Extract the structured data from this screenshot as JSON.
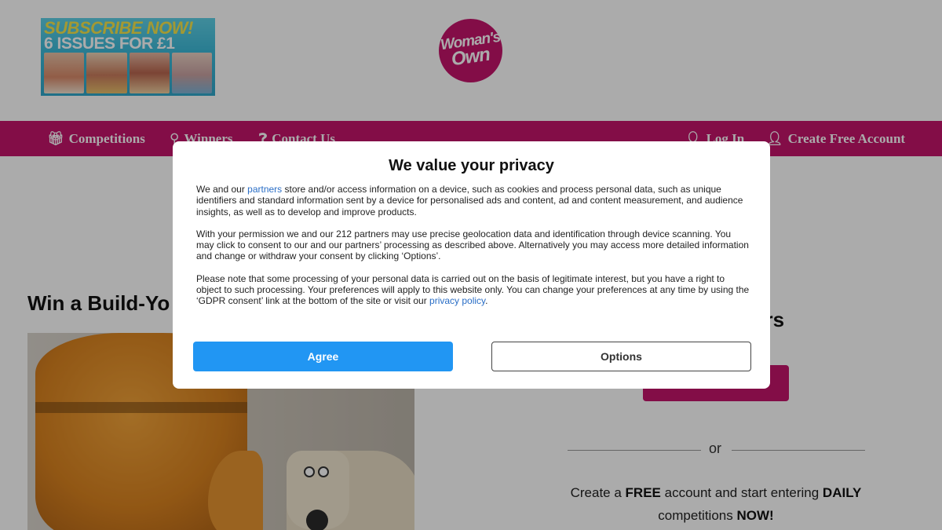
{
  "header": {
    "promo": {
      "line1": "SUBSCRIBE NOW!",
      "line2": "6 ISSUES FOR £1"
    },
    "logo": {
      "line1": "Woman's",
      "line2": "Own"
    }
  },
  "nav": {
    "competitions": "Competitions",
    "winners": "Winners",
    "contact": "Contact Us",
    "login": "Log In",
    "create_account": "Create Free Account"
  },
  "icons": {
    "competitions": "gift-icon",
    "winners": "map-marker-icon",
    "contact": "question-icon",
    "login": "user-icon",
    "create_account": "user-plus-icon"
  },
  "content": {
    "headline": "Win a Build-Yo",
    "right_heading": "ers",
    "or_text": "or",
    "cta": {
      "p1": "Create a ",
      "b1": "FREE",
      "p2": " account and start entering ",
      "b2": "DAILY",
      "p3": " competitions ",
      "b3": "NOW!"
    }
  },
  "consent": {
    "title": "We value your privacy",
    "para1_before_link": "We and our ",
    "para1_link": "partners",
    "para1_after_link": " store and/or access information on a device, such as cookies and process personal data, such as unique identifiers and standard information sent by a device for personalised ads and content, ad and content measurement, and audience insights, as well as to develop and improve products.",
    "para2": "With your permission we and our 212 partners may use precise geolocation data and identification through device scanning. You may click to consent to our and our partners’ processing as described above. Alternatively you may access more detailed information and change or withdraw your consent by clicking ‘Options’.",
    "para3_before_link": "Please note that some processing of your personal data is carried out on the basis of legitimate interest, but you have a right to object to such processing. Your preferences will apply to this website only. You can change your preferences at any time by using the ‘GDPR consent’ link at the bottom of the site or visit our ",
    "para3_link": "privacy policy",
    "para3_after_link": ".",
    "agree_label": "Agree",
    "options_label": "Options"
  },
  "colors": {
    "brand_magenta": "#c4146b",
    "agree_blue": "#2196f3",
    "link_blue": "#2a6ec6"
  }
}
